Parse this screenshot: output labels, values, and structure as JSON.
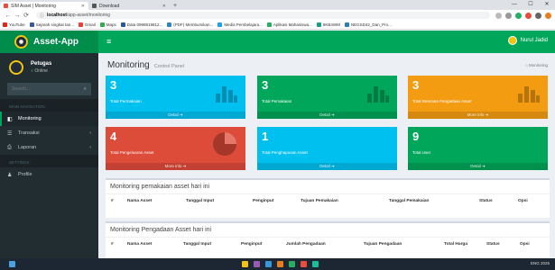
{
  "browser": {
    "tabs": [
      {
        "title": "SIM Asset | Monitoring",
        "active": true,
        "favicon_color": "#e74c3c"
      },
      {
        "title": "Download",
        "active": false,
        "favicon_color": "#555555"
      }
    ],
    "new_tab": "+",
    "url_host": "localhost",
    "url_path": "/app-asset/monitoring",
    "bookmarks": [
      {
        "label": "YouTube",
        "color": "#e62117"
      },
      {
        "label": "Sejarah singkat tan...",
        "color": "#3b5998"
      },
      {
        "label": "Gmail",
        "color": "#ea4335"
      },
      {
        "label": "Maps",
        "color": "#34a853"
      },
      {
        "label": "Data 0998819812...",
        "color": "#2b579a"
      },
      {
        "label": "(PDF) Membumikan...",
        "color": "#2e86c1"
      },
      {
        "label": "Media Pembelajara...",
        "color": "#1da1f2"
      },
      {
        "label": "Aplikasi Mahasiswa...",
        "color": "#27ae60"
      },
      {
        "label": "9KB4WM",
        "color": "#16a085"
      },
      {
        "label": "NEGSD42_Dan_Pro...",
        "color": "#2980b9"
      }
    ]
  },
  "app": {
    "name": "Asset-App",
    "user_top": "Nurul Jadid",
    "user_panel": {
      "name": "Petugas",
      "status": "Online"
    },
    "search_placeholder": "Search...",
    "nav_header": "MAIN NAVIGATION",
    "settings_header": "SETTINGS",
    "menu": [
      {
        "label": "Monitoring",
        "icon": "dashboard-icon",
        "active": true,
        "has_children": false
      },
      {
        "label": "Transaksi",
        "icon": "list-icon",
        "active": false,
        "has_children": true
      },
      {
        "label": "Laporan",
        "icon": "print-icon",
        "active": false,
        "has_children": true
      }
    ],
    "settings_menu": [
      {
        "label": "Profile",
        "icon": "user-icon"
      }
    ],
    "page_title": "Monitoring",
    "page_subtitle": "Control Panel",
    "breadcrumb": "Monitoring",
    "stat_boxes": [
      {
        "value": "3",
        "label": "Total Permakaian",
        "footer": "Detail",
        "color": "#00c0ef",
        "icon": "bar-chart-icon"
      },
      {
        "value": "3",
        "label": "Total Pemakaian",
        "footer": "Detail",
        "color": "#00a65a",
        "icon": "bar-chart-icon"
      },
      {
        "value": "3",
        "label": "Total Rencana Pengadaan Asset",
        "footer": "More info",
        "color": "#f39c12",
        "icon": "bar-chart-icon"
      },
      {
        "value": "4",
        "label": "Total Pengeluaran Asset",
        "footer": "More info",
        "color": "#dd4b39",
        "icon": "pie-chart-icon"
      },
      {
        "value": "1",
        "label": "Total Penghapusan Asset",
        "footer": "Detail",
        "color": "#00c0ef",
        "icon": "none"
      },
      {
        "value": "9",
        "label": "Total User",
        "footer": "Detail",
        "color": "#00a65a",
        "icon": "none"
      }
    ],
    "tables": [
      {
        "title": "Monitoring pemakaian asset hari ini",
        "columns": [
          "#",
          "Nama Asset",
          "Tanggal Input",
          "Penginput",
          "Tujuan Pemakaian",
          "Tanggal Pemakaian",
          "Status",
          "Opsi"
        ]
      },
      {
        "title": "Monitoring Pengadaan Asset hari ini",
        "columns": [
          "#",
          "Nama Asset",
          "Tanggal Input",
          "Penginput",
          "Jumlah Pengadaan",
          "Tujuan Pengadaan",
          "Total Harga",
          "Status",
          "Opsi"
        ]
      }
    ]
  },
  "taskbar": {
    "tray_text": "ENG  2025"
  }
}
